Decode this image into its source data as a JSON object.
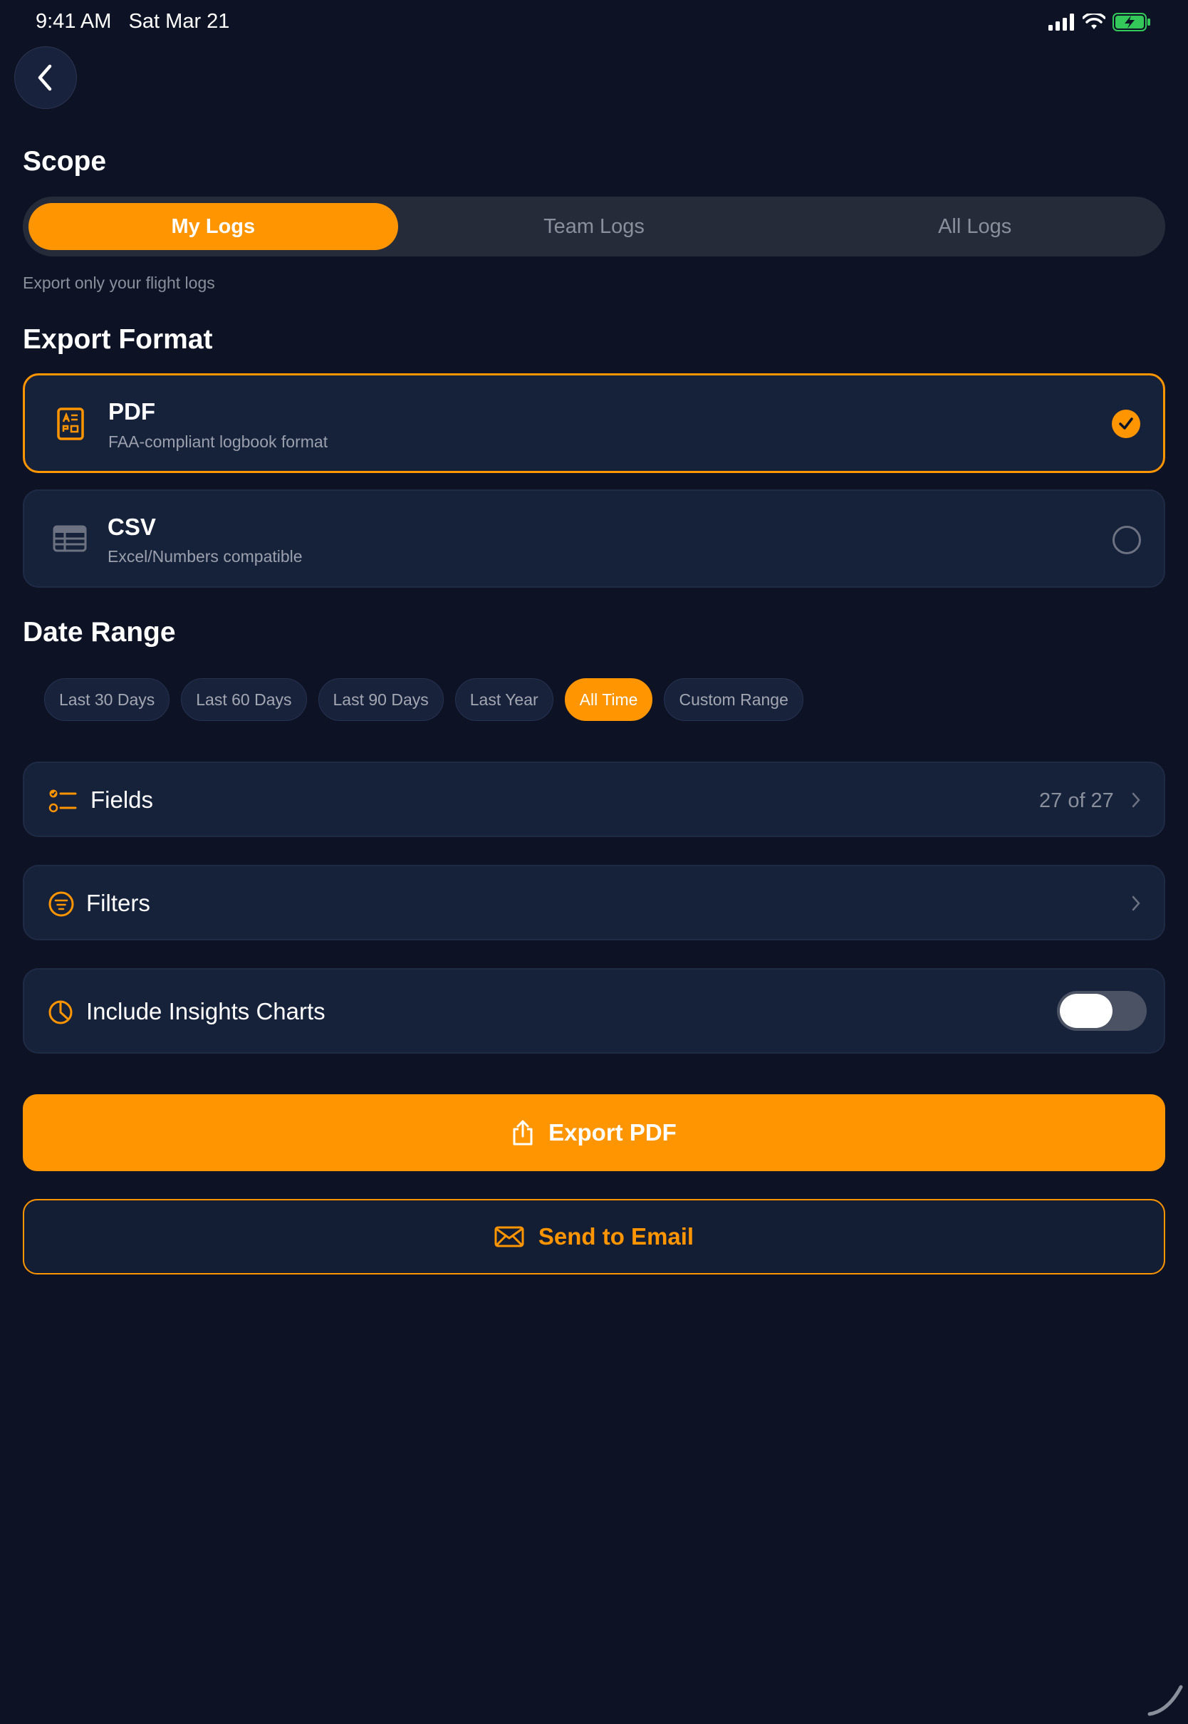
{
  "status_bar": {
    "time": "9:41 AM",
    "date": "Sat Mar 21",
    "icons": [
      "signal-icon",
      "wifi-icon",
      "battery-charging-icon"
    ]
  },
  "scope": {
    "title": "Scope",
    "options": [
      "My Logs",
      "Team Logs",
      "All Logs"
    ],
    "selected": "My Logs",
    "hint": "Export only your flight logs"
  },
  "export_format": {
    "title": "Export Format",
    "options": [
      {
        "label": "PDF",
        "description": "FAA-compliant logbook format",
        "icon": "document-icon",
        "selected": true
      },
      {
        "label": "CSV",
        "description": "Excel/Numbers compatible",
        "icon": "table-icon",
        "selected": false
      }
    ]
  },
  "date_range": {
    "title": "Date Range",
    "options": [
      "Last 30 Days",
      "Last 60 Days",
      "Last 90 Days",
      "Last Year",
      "All Time",
      "Custom Range"
    ],
    "selected": "All Time"
  },
  "fields": {
    "label": "Fields",
    "value": "27 of 27",
    "icon": "checklist-icon"
  },
  "filters": {
    "label": "Filters",
    "icon": "filter-icon"
  },
  "insights": {
    "label": "Include Insights Charts",
    "icon": "pie-chart-icon",
    "enabled": false
  },
  "actions": {
    "export_label": "Export PDF",
    "email_label": "Send to Email"
  },
  "colors": {
    "accent": "#ff9500",
    "background": "#0d1325",
    "card": "#16213a"
  }
}
